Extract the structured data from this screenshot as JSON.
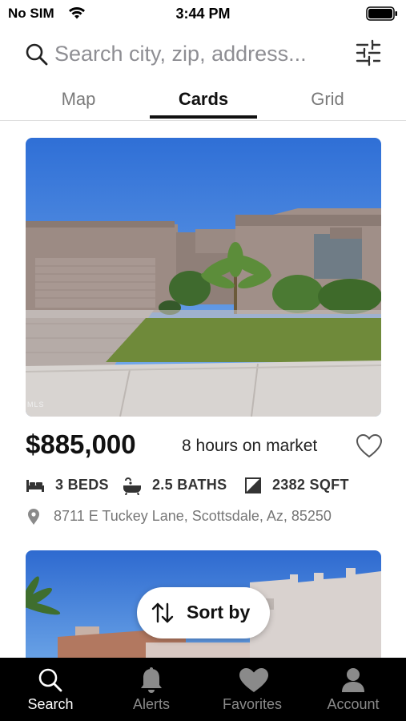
{
  "status_bar": {
    "carrier": "No SIM",
    "time": "3:44 PM",
    "icons": [
      "wifi-icon",
      "battery-icon"
    ]
  },
  "search": {
    "placeholder": "Search city, zip, address...",
    "value": "",
    "icons": [
      "search-icon",
      "filter-sliders-icon"
    ]
  },
  "view_tabs": {
    "items": [
      {
        "label": "Map",
        "active": false
      },
      {
        "label": "Cards",
        "active": true
      },
      {
        "label": "Grid",
        "active": false
      }
    ]
  },
  "listings": [
    {
      "photo_watermark": "MLS",
      "price": "$885,000",
      "time_on_market": "8 hours on market",
      "favorited": false,
      "beds": "3 BEDS",
      "baths": "2.5 BATHS",
      "sqft": "2382 SQFT",
      "address": "8711 E Tuckey Lane, Scottsdale, Az, 85250"
    }
  ],
  "sort_button": {
    "label": "Sort by",
    "icon": "sort-arrows-icon"
  },
  "bottom_nav": {
    "items": [
      {
        "label": "Search",
        "icon": "search-icon",
        "active": true
      },
      {
        "label": "Alerts",
        "icon": "bell-icon",
        "active": false
      },
      {
        "label": "Favorites",
        "icon": "heart-icon",
        "active": false
      },
      {
        "label": "Account",
        "icon": "person-icon",
        "active": false
      }
    ]
  },
  "colors": {
    "active_tab": "#111111",
    "inactive_tab": "#7a7a7a",
    "secondary_text": "#777777",
    "tab_bar_background": "#000000",
    "tab_bar_active": "#ffffff",
    "tab_bar_inactive": "#8a8a8a"
  }
}
